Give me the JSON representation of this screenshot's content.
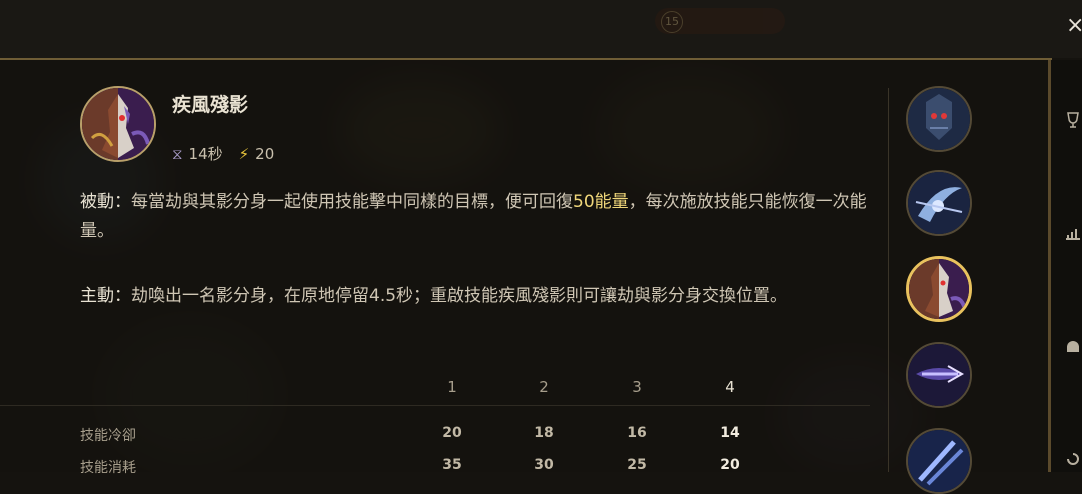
{
  "header": {
    "level_badge": "15",
    "close_glyph": "×"
  },
  "ability": {
    "name": "疾風殘影",
    "cooldown": "14秒",
    "cost": "20"
  },
  "description": {
    "passive_label": "被動：",
    "passive_text_1": "每當劫與其影分身一起使用技能擊中同樣的目標，便可回復",
    "passive_energy": "50能量",
    "passive_text_2": "，每次施放技能只能恢復一次能量。",
    "active_label": "主動：",
    "active_text": "劫喚出一名影分身，在原地停留4.5秒；重啟技能疾風殘影則可讓劫與影分身交換位置。"
  },
  "table": {
    "levels": [
      "1",
      "2",
      "3",
      "4"
    ],
    "rows": [
      {
        "label": "技能冷卻",
        "values": [
          "20",
          "18",
          "16",
          "14"
        ]
      },
      {
        "label": "技能消耗",
        "values": [
          "35",
          "30",
          "25",
          "20"
        ]
      }
    ]
  },
  "skills": [
    {
      "name": "passive",
      "active": false
    },
    {
      "name": "q",
      "active": false
    },
    {
      "name": "w",
      "active": true
    },
    {
      "name": "e",
      "active": false
    },
    {
      "name": "r",
      "active": false
    }
  ],
  "colors": {
    "accent_gold": "#e9c25e",
    "energy": "#f0d77a",
    "divider": "#6f5d36"
  }
}
